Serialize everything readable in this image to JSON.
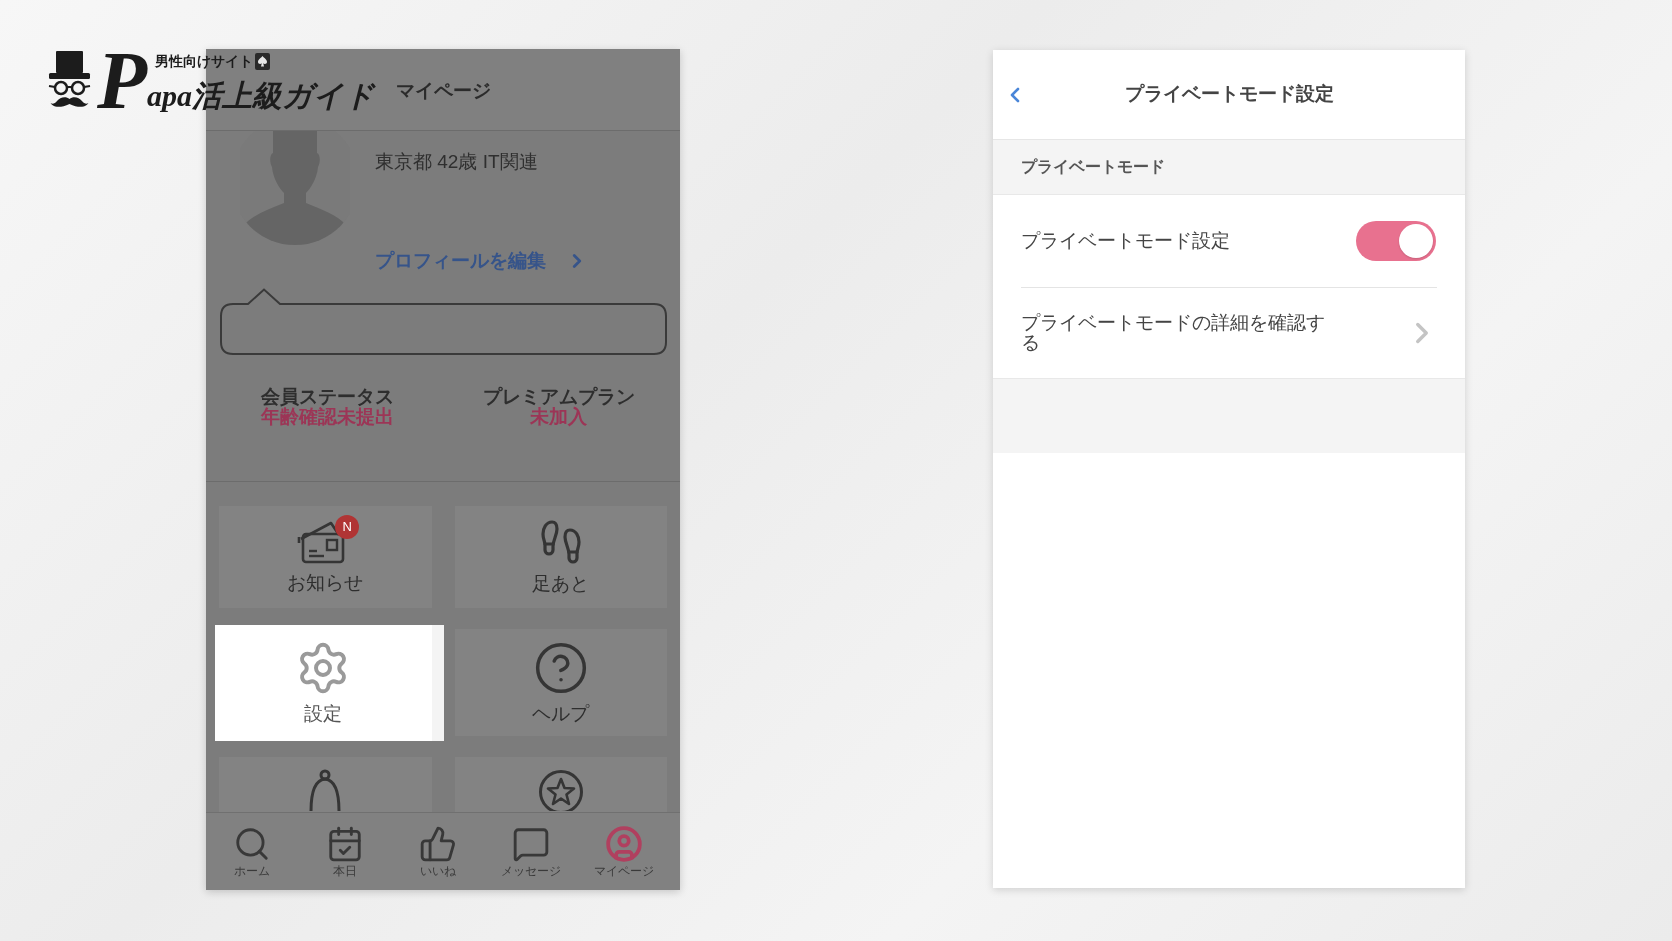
{
  "logo": {
    "tagline": "男性向けサイト",
    "initial": "P",
    "wordmark": "apa活上級ガイド"
  },
  "mypage_screen": {
    "header_title": "マイページ",
    "profile": {
      "details": "東京都 42歳 IT関連",
      "edit_link": "プロフィールを編集"
    },
    "status": [
      {
        "label": "会員ステータス",
        "value": "年齢確認未提出"
      },
      {
        "label": "プレミアムプラン",
        "value": "未加入"
      }
    ],
    "menu_tiles": [
      {
        "label": "お知らせ",
        "badge": "N",
        "highlighted": false
      },
      {
        "label": "足あと",
        "highlighted": false
      },
      {
        "label": "設定",
        "highlighted": true
      },
      {
        "label": "ヘルプ",
        "highlighted": false
      },
      {
        "highlighted": false
      },
      {
        "highlighted": false
      }
    ],
    "tab_bar": [
      {
        "label": "ホーム",
        "selected": false
      },
      {
        "label": "本日",
        "selected": false
      },
      {
        "label": "いいね",
        "selected": false
      },
      {
        "label": "メッセージ",
        "selected": false
      },
      {
        "label": "マイページ",
        "selected": true
      }
    ]
  },
  "settings_screen": {
    "title": "プライベートモード設定",
    "section_header": "プライベートモード",
    "rows": [
      {
        "kind": "toggle",
        "label": "プライベートモード設定",
        "on": true
      },
      {
        "kind": "link",
        "label": "プライベートモードの詳細を確認する"
      }
    ]
  }
}
